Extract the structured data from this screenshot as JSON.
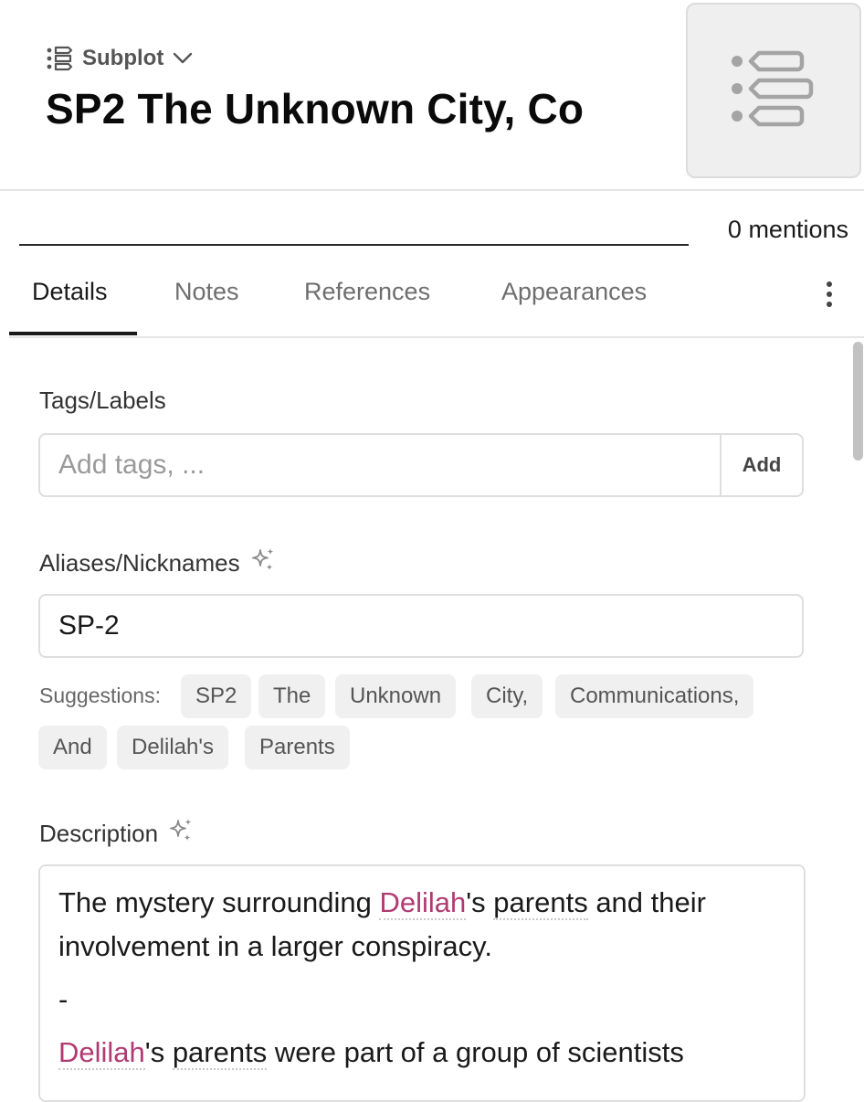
{
  "header": {
    "type_label": "Subplot",
    "title": "SP2 The Unknown City, Co"
  },
  "mentions": "0 mentions",
  "tabs": [
    {
      "label": "Details",
      "active": true
    },
    {
      "label": "Notes",
      "active": false
    },
    {
      "label": "References",
      "active": false
    },
    {
      "label": "Appearances",
      "active": false
    }
  ],
  "tags": {
    "label": "Tags/Labels",
    "placeholder": "Add tags, ...",
    "value": "",
    "add_label": "Add"
  },
  "aliases": {
    "label": "Aliases/Nicknames",
    "value": "SP-2",
    "suggestions_label": "Suggestions:",
    "suggestions": [
      "SP2",
      "The",
      "Unknown",
      "City,",
      "Communications,",
      "And",
      "Delilah's",
      "Parents"
    ]
  },
  "description": {
    "label": "Description",
    "p1_link1": "Delilah",
    "p1_link2": "parents",
    "p1_pre": "The mystery surrounding ",
    "p1_mid": "'s ",
    "p1_post": " and their involvement in a larger conspiracy.",
    "p2": "-",
    "p3_link1": "Delilah",
    "p3_mid": "'s ",
    "p3_link2": "parents",
    "p3_post": " were part of a group of scientists"
  },
  "colors": {
    "link_pink": "#b03a71",
    "icon_gray": "#a4a4a4"
  },
  "icons": {
    "type": "subplot-list-icon",
    "dropdown": "chevron-down-icon",
    "more": "more-vertical-icon",
    "ai": "sparkle-icon"
  }
}
